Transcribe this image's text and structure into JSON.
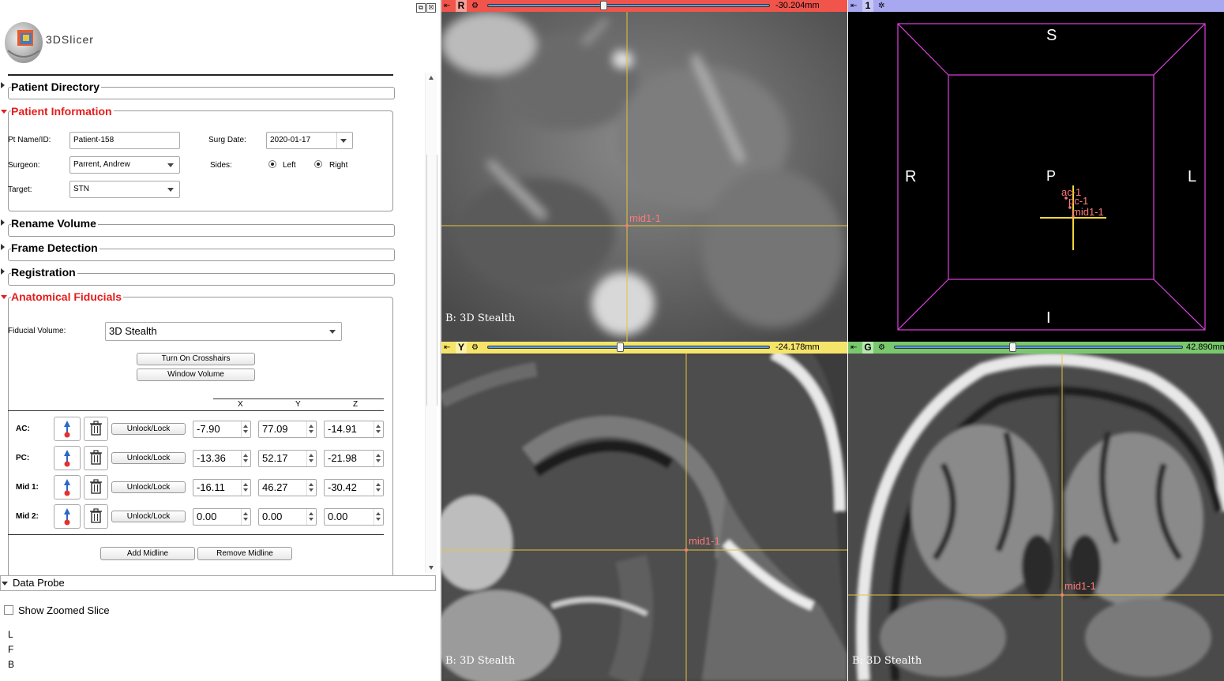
{
  "app": {
    "name": "3DSlicer"
  },
  "window_buttons": [
    "⧉",
    "☒"
  ],
  "sections": {
    "patient_directory": "Patient Directory",
    "patient_information": "Patient Information",
    "rename_volume": "Rename Volume",
    "frame_detection": "Frame Detection",
    "registration": "Registration",
    "anatomical_fiducials": "Anatomical Fiducials",
    "data_probe": "Data Probe"
  },
  "patient": {
    "name_label": "Pt Name/ID:",
    "name_value": "Patient-158",
    "surg_date_label": "Surg Date:",
    "surg_date_value": "2020-01-17",
    "surgeon_label": "Surgeon:",
    "surgeon_value": "Parrent, Andrew",
    "sides_label": "Sides:",
    "side_left": "Left",
    "side_right": "Right",
    "target_label": "Target:",
    "target_value": "STN"
  },
  "fiducials": {
    "volume_label": "Fiducial Volume:",
    "volume_value": "3D Stealth",
    "crosshairs_button": "Turn On Crosshairs",
    "window_button": "Window Volume",
    "columns": [
      "X",
      "Y",
      "Z"
    ],
    "lock_label": "Unlock/Lock",
    "rows": [
      {
        "label": "AC:",
        "x": "-7.90",
        "y": "77.09",
        "z": "-14.91"
      },
      {
        "label": "PC:",
        "x": "-13.36",
        "y": "52.17",
        "z": "-21.98"
      },
      {
        "label": "Mid 1:",
        "x": "-16.11",
        "y": "46.27",
        "z": "-30.42"
      },
      {
        "label": "Mid 2:",
        "x": "0.00",
        "y": "0.00",
        "z": "0.00"
      }
    ],
    "add_midline": "Add Midline",
    "remove_midline": "Remove Midline"
  },
  "data_probe": {
    "show_zoomed": "Show Zoomed Slice",
    "lines": [
      "L",
      "F",
      "B"
    ]
  },
  "views": {
    "red": {
      "letter": "R",
      "offset": "-30.204mm",
      "slider_fraction": 0.41,
      "volume": "B: 3D Stealth",
      "fiducial": "mid1-1",
      "color": "#f0544b"
    },
    "threed": {
      "letter": "1",
      "color": "#a8a8f0",
      "orient": {
        "S": "S",
        "I": "I",
        "R": "R",
        "L": "L",
        "P": "P"
      },
      "fiducials": [
        "ac-1",
        "pc-1",
        "mid1-1"
      ]
    },
    "yellow": {
      "letter": "Y",
      "offset": "-24.178mm",
      "slider_fraction": 0.47,
      "volume": "B: 3D Stealth",
      "fiducial": "mid1-1",
      "color": "#f5e46a"
    },
    "green": {
      "letter": "G",
      "offset": "42.890mm",
      "slider_fraction": 0.41,
      "volume": "B: 3D Stealth",
      "fiducial": "mid1-1",
      "color": "#7ac86e"
    }
  }
}
